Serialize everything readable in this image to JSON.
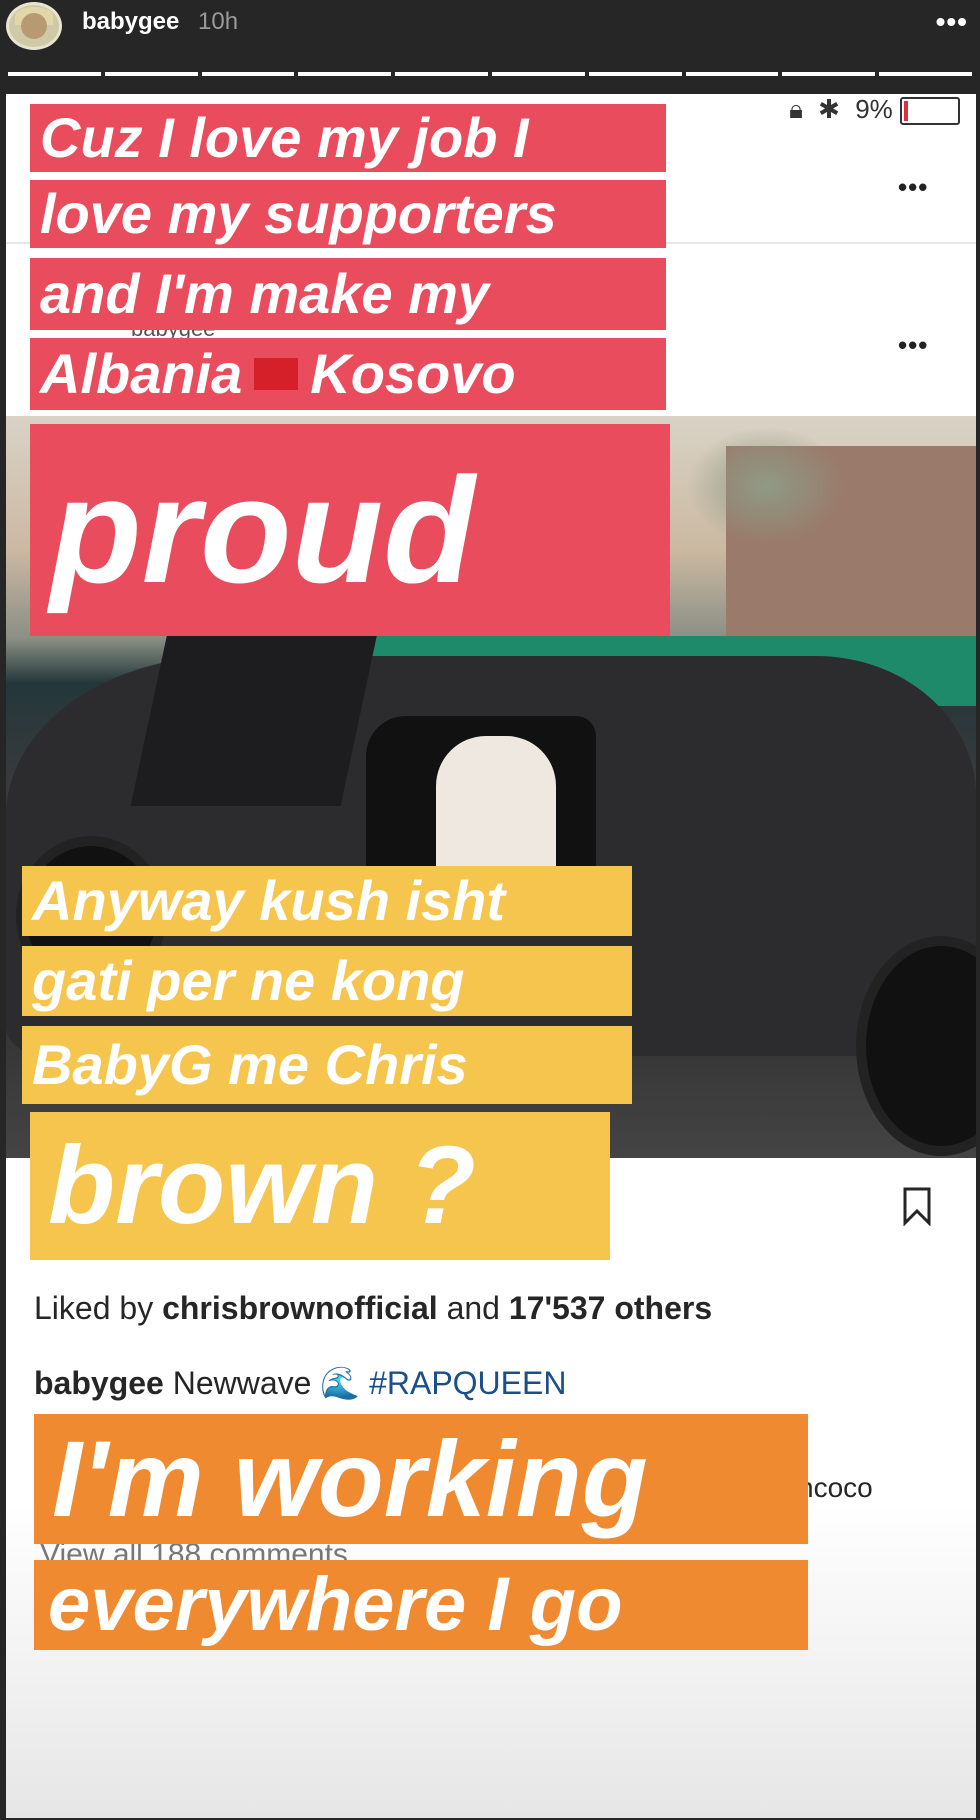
{
  "story_header": {
    "username": "babygee",
    "time": "10h",
    "more_icon": "more-horizontal-icon",
    "segments": 10
  },
  "status_bar": {
    "battery": "9%"
  },
  "post": {
    "ghost_username": "babygee",
    "liked_by_prefix": "Liked by",
    "liked_by_user": "chrisbrownofficial",
    "liked_by_middle": "and",
    "liked_by_count": "17'537 others",
    "caption_user": "babygee",
    "caption_text": "Newwave 🌊",
    "caption_hashtag": "#RAPQUEEN",
    "tag_fragment": "ncoco",
    "view_comments": "View all 188 comments"
  },
  "overlays": {
    "red_lines": [
      "Cuz I love my job I",
      "love my supporters",
      "and I'm make my"
    ],
    "red_line4_a": "Albania",
    "red_line4_b": "Kosovo",
    "flag_icon": "albania-flag-icon",
    "proud": "proud",
    "yellow_lines": [
      "Anyway kush isht",
      "gati per ne kong",
      "BabyG me Chris"
    ],
    "brown": "brown ?",
    "orange_big": "I'm working",
    "orange_small": "everywhere I go"
  },
  "colors": {
    "red": "#e84c5d",
    "yellow": "#f6c54e",
    "orange": "#f08a30",
    "hashtag": "#1b4f8a"
  }
}
